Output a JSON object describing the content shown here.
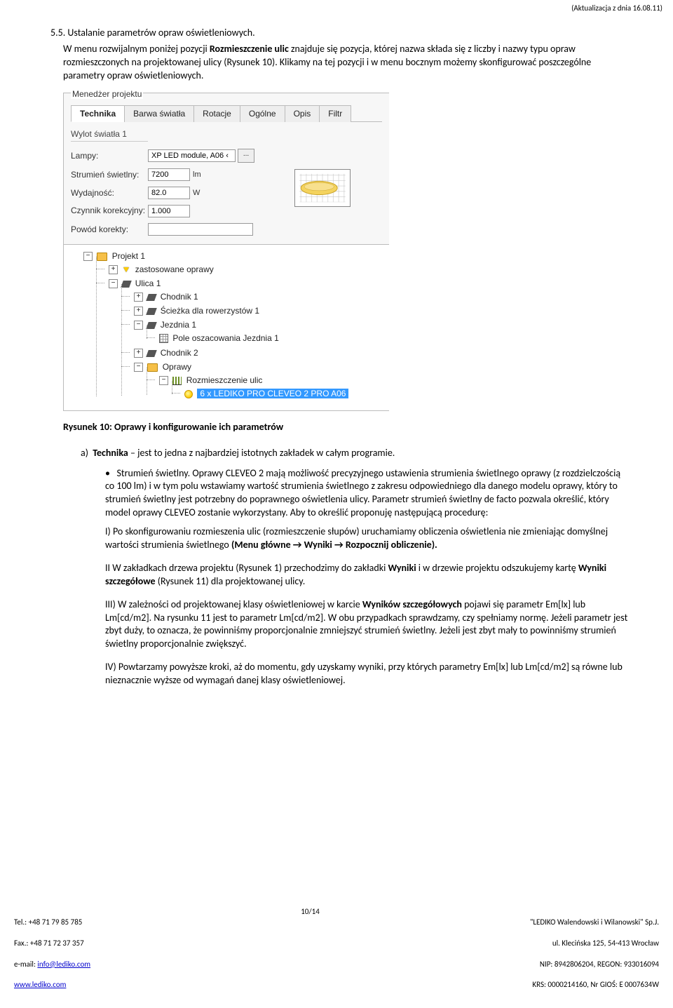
{
  "header_update": "(Aktualizacja z dnia 16.08.11)",
  "section": "5.5. Ustalanie parametrów opraw oświetleniowych.",
  "intro": "W menu rozwijalnym poniżej pozycji Rozmieszczenie ulic znajduje się pozycja, której nazwa składa się z liczby i nazwy typu opraw rozmieszczonych na projektowanej ulicy (Rysunek 10). Klikamy na tej pozycji i w menu bocznym możemy skonfigurować poszczególne parametry opraw oświetleniowych.",
  "panel": {
    "title": "Menedżer projektu",
    "tabs": [
      "Technika",
      "Barwa światła",
      "Rotacje",
      "Ogólne",
      "Opis",
      "Filtr"
    ],
    "active_tab": 0,
    "subtab": "Wylot światła 1",
    "rows": {
      "lampy": {
        "label": "Lampy:",
        "value": "XP LED module, A06 ‹"
      },
      "strumien": {
        "label": "Strumień świetlny:",
        "value": "7200",
        "unit": "lm"
      },
      "wydajnosc": {
        "label": "Wydajność:",
        "value": "82.0",
        "unit": "W"
      },
      "czynnik": {
        "label": "Czynnik korekcyjny:",
        "value": "1.000"
      },
      "powod": {
        "label": "Powód korekty:",
        "value": ""
      }
    },
    "dots": "..."
  },
  "tree": {
    "root": "Projekt 1",
    "items": [
      {
        "label": "zastosowane oprawy",
        "icon": "lamp",
        "toggle": "+"
      },
      {
        "label": "Ulica 1",
        "icon": "road",
        "toggle": "−",
        "children": [
          {
            "label": "Chodnik 1",
            "icon": "road",
            "toggle": "+"
          },
          {
            "label": "Ścieżka dla rowerzystów 1",
            "icon": "road",
            "toggle": "+"
          },
          {
            "label": "Jezdnia 1",
            "icon": "road",
            "toggle": "−",
            "children": [
              {
                "label": "Pole oszacowania Jezdnia 1",
                "icon": "grid-ico"
              }
            ]
          },
          {
            "label": "Chodnik 2",
            "icon": "road",
            "toggle": "+"
          },
          {
            "label": "Oprawy",
            "icon": "folder",
            "toggle": "−",
            "children": [
              {
                "label": "Rozmieszczenie ulic",
                "icon": "bars",
                "toggle": "−",
                "children": [
                  {
                    "label": "6 x LEDIKO PRO  CLEVEO 2 PRO A06",
                    "icon": "bulb",
                    "selected": true
                  }
                ]
              }
            ]
          }
        ]
      }
    ]
  },
  "caption": "Rysunek 10: Oprawy i konfigurowanie ich parametrów",
  "item_a": "Technika – jest to jedna z najbardziej istotnych zakładek w całym programie.",
  "bullet1_head": "Strumień świetlny.",
  "bullet1_rest": " Oprawy CLEVEO 2 mają możliwość precyzyjnego ustawienia strumienia świetlnego oprawy (z rozdzielczością co 100 lm) i w tym polu wstawiamy wartość strumienia świetlnego z zakresu odpowiedniego dla danego modelu oprawy, który to strumień świetlny jest potrzebny do poprawnego oświetlenia ulicy. Parametr strumień świetlny de facto pozwala określić, który model oprawy CLEVEO zostanie wykorzystany. Aby to określić proponuję następującą procedurę:",
  "r1_a": "I) Po skonfigurowaniu rozmieszenia ulic (rozmieszczenie słupów) uruchamiamy obliczenia oświetlenia nie zmieniając domyślnej wartości strumienia świetlnego ",
  "r1_b": "(Menu główne → Wyniki → Rozpocznij obliczenie).",
  "r2_a": "II W zakładkach drzewa projektu (Rysunek 1) przechodzimy do zakładki ",
  "r2_b": "Wyniki",
  "r2_c": " i w drzewie projektu odszukujemy kartę ",
  "r2_d": "Wyniki szczegółowe",
  "r2_e": " (Rysunek 11) dla projektowanej ulicy.",
  "r3_a": "III) W zależności od projektowanej klasy oświetleniowej w karcie ",
  "r3_b": "Wyników szczegółowych",
  "r3_c": " pojawi się parametr Em[lx] lub Lm[cd/m2]. Na rysunku 11 jest to parametr Lm[cd/m2]. W obu przypadkach sprawdzamy, czy spełniamy normę. Jeżeli parametr jest zbyt duży, to oznacza, że powinniśmy proporcjonalnie zmniejszyć strumień świetlny. Jeżeli jest zbyt mały to powinniśmy strumień świetlny proporcjonalnie zwiększyć.",
  "r4": "IV) Powtarzamy powyższe kroki, aż do momentu, gdy uzyskamy wyniki, przy których parametry Em[lx] lub Lm[cd/m2] są równe lub nieznacznie wyższe od wymagań danej klasy oświetleniowej.",
  "footer": {
    "left_l1": "Tel.: +48 71 79 85 785",
    "left_l2": "Fax.: +48 71 72 37 357",
    "left_l3_pre": "e-mail: ",
    "left_l3_link": "info@lediko.com",
    "left_l4": "www.lediko.com",
    "center": "10/14",
    "right_l1": "\"LEDIKO Walendowski i Wilanowski\" Sp.J.",
    "right_l2": "ul. Klecińska 125, 54-413 Wrocław",
    "right_l3": "NIP: 8942806204, REGON: 933016094",
    "right_l4": "KRS: 0000214160, Nr GIOŚ: E 0007634W"
  }
}
